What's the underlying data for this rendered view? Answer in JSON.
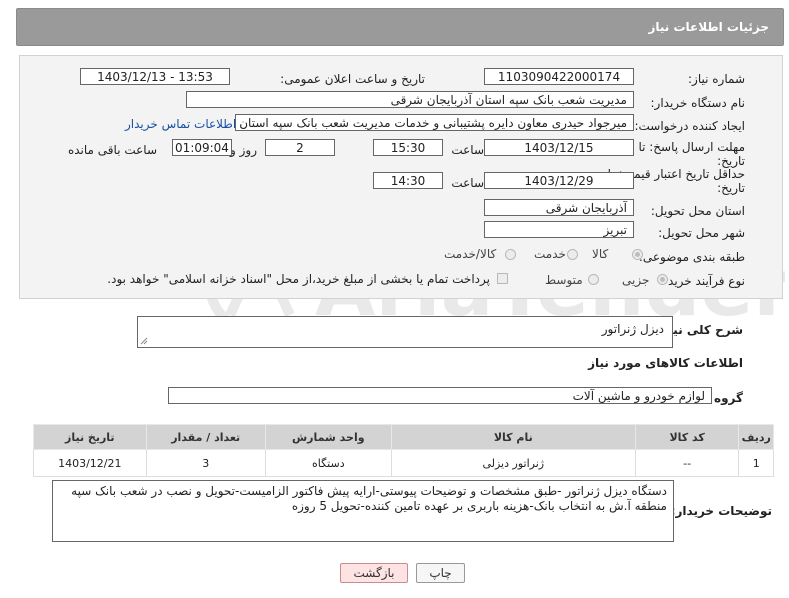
{
  "header": {
    "title": "جزئیات اطلاعات نیاز"
  },
  "form": {
    "need_number_label": "شماره نیاز:",
    "need_number": "1103090422000174",
    "announce_datetime_label": "تاریخ و ساعت اعلان عمومی:",
    "announce_datetime": "1403/12/13 - 13:53",
    "buyer_org_label": "نام دستگاه خریدار:",
    "buyer_org": "مدیریت شعب بانک سپه استان آذربایجان شرقی",
    "requester_label": "ایجاد کننده درخواست:",
    "requester": "میرجواد حیدری معاون دایره پشتیبانی و خدمات مدیریت شعب بانک سپه استان آ",
    "contact_link": "اطلاعات تماس خریدار",
    "reply_deadline_label": "مهلت ارسال پاسخ: تا",
    "reply_deadline_label2": "تاریخ:",
    "reply_date": "1403/12/15",
    "time_label": "ساعت",
    "reply_time": "15:30",
    "days_value": "2",
    "days_label": "روز و",
    "remaining_time": "01:09:04",
    "remaining_label": "ساعت باقی مانده",
    "validity_label": "حداقل تاریخ اعتبار قیمت: تا",
    "validity_label2": "تاریخ:",
    "validity_date": "1403/12/29",
    "validity_time": "14:30",
    "province_label": "استان محل تحویل:",
    "province": "آذربایجان شرقی",
    "city_label": "شهر محل تحویل:",
    "city": "تبریز",
    "category_label": "طبقه بندی موضوعی:",
    "category_options": [
      "کالا",
      "خدمت",
      "کالا/خدمت"
    ],
    "category_selected": "کالا",
    "process_label": "نوع فرآیند خرید :",
    "process_options": [
      "جزیی",
      "متوسط"
    ],
    "process_selected": "جزیی",
    "payment_note": "پرداخت تمام یا بخشی از مبلغ خرید،از محل \"اسناد خزانه اسلامی\" خواهد بود."
  },
  "summary": {
    "label": "شرح کلی نیاز:",
    "value": "دیزل ژنراتور"
  },
  "goods_info_title": "اطلاعات کالاهای مورد نیاز",
  "goods_group": {
    "label": "گروه کالا:",
    "value": "لوازم خودرو و ماشین آلات"
  },
  "table": {
    "headers": [
      "ردیف",
      "کد کالا",
      "نام کالا",
      "واحد شمارش",
      "تعداد / مقدار",
      "تاریخ نیاز"
    ],
    "rows": [
      [
        "1",
        "--",
        "ژنراتور دیزلی",
        "دستگاه",
        "3",
        "1403/12/21"
      ]
    ]
  },
  "buyer_notes": {
    "label": "توضیحات خریدار:",
    "value": "دستگاه دیزل ژنراتور -طبق مشخصات و توضیحات پیوستی-ارایه پیش فاکتور الزامیست-تحویل و نصب در شعب بانک سپه منطقه آ.ش به انتخاب بانک-هزینه باربری بر عهده تامین کننده-تحویل 5 روزه"
  },
  "buttons": {
    "print": "چاپ",
    "back": "بازگشت"
  },
  "watermark": {
    "text": "AriaTender.neT"
  },
  "colors": {
    "header_bg": "#9a9a9a",
    "panel_bg": "#f3f3f3",
    "link": "#1a4fa3",
    "back_btn": "#fde3e3"
  }
}
